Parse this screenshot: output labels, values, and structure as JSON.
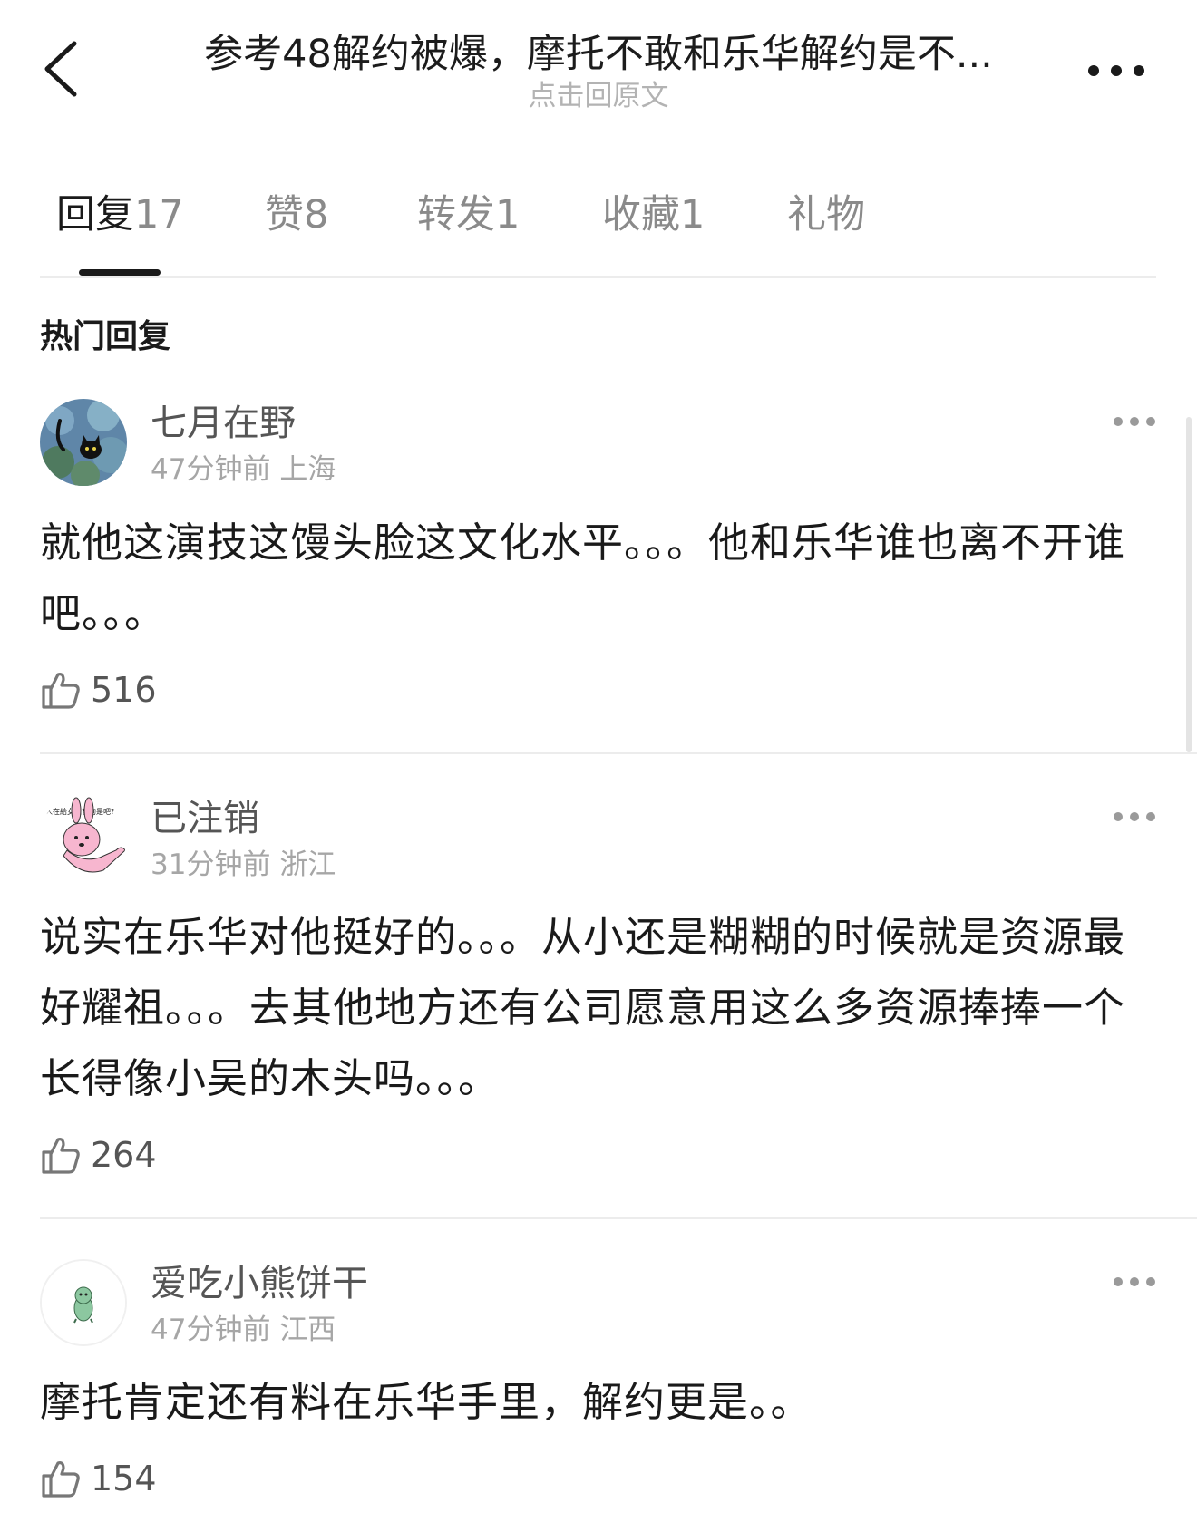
{
  "header": {
    "title": "参考48解约被爆，摩托不敢和乐华解约是不...",
    "subtitle": "点击回原文",
    "back_icon": "chevron-left-icon",
    "more_icon": "more-horizontal-icon"
  },
  "tabs": [
    {
      "label": "回复",
      "count": "17",
      "active": true
    },
    {
      "label": "赞",
      "count": "8",
      "active": false
    },
    {
      "label": "转发",
      "count": "1",
      "active": false
    },
    {
      "label": "收藏",
      "count": "1",
      "active": false
    },
    {
      "label": "礼物",
      "count": "",
      "active": false
    }
  ],
  "section_title": "热门回复",
  "comments": [
    {
      "username": "七月在野",
      "time": "47分钟前",
      "location": "上海",
      "content": "就他这演技这馒头脸这文化水平。。。他和乐华谁也离不开谁吧。。。",
      "likes": "516",
      "avatar_icon": "black-cat-avatar"
    },
    {
      "username": "已注销",
      "time": "31分钟前",
      "location": "浙江",
      "content": "说实在乐华对他挺好的。。。从小还是糊糊的时候就是资源最好耀祖。。。去其他地方还有公司愿意用这么多资源捧捧一个长得像小吴的木头吗。。。",
      "likes": "264",
      "avatar_icon": "pink-rabbit-avatar"
    },
    {
      "username": "爱吃小熊饼干",
      "time": "47分钟前",
      "location": "江西",
      "content": "摩托肯定还有料在乐华手里，解约更是。。",
      "likes": "154",
      "avatar_icon": "green-dinosaur-avatar"
    }
  ],
  "colors": {
    "text": "#1a1a1a",
    "secondary_text": "#a6a6a6",
    "username": "#555555",
    "divider": "#ececec",
    "background": "#ffffff"
  }
}
